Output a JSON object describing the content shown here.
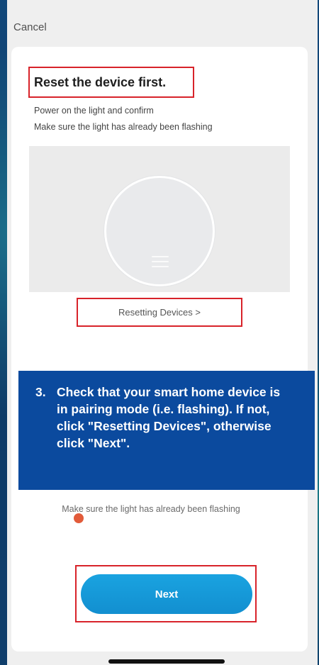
{
  "header": {
    "cancel_label": "Cancel"
  },
  "card": {
    "title": "Reset the device first.",
    "subtitle_line1": "Power on the light and confirm",
    "subtitle_line2": "Make sure the light has already been flashing",
    "reset_link": "Resetting Devices >"
  },
  "instruction": {
    "number": "3.",
    "text": "Check that your smart home device is in pairing mode (i.e. flashing). If not, click \"Reset­ting Devices\", otherwise click \"Next\"."
  },
  "footer": {
    "warning_text": "Make sure the light has already been flashing",
    "next_label": "Next"
  },
  "colors": {
    "highlight_border": "#d8232a",
    "overlay_bg": "#0b4a9e",
    "button_bg": "#1aa3e0"
  }
}
